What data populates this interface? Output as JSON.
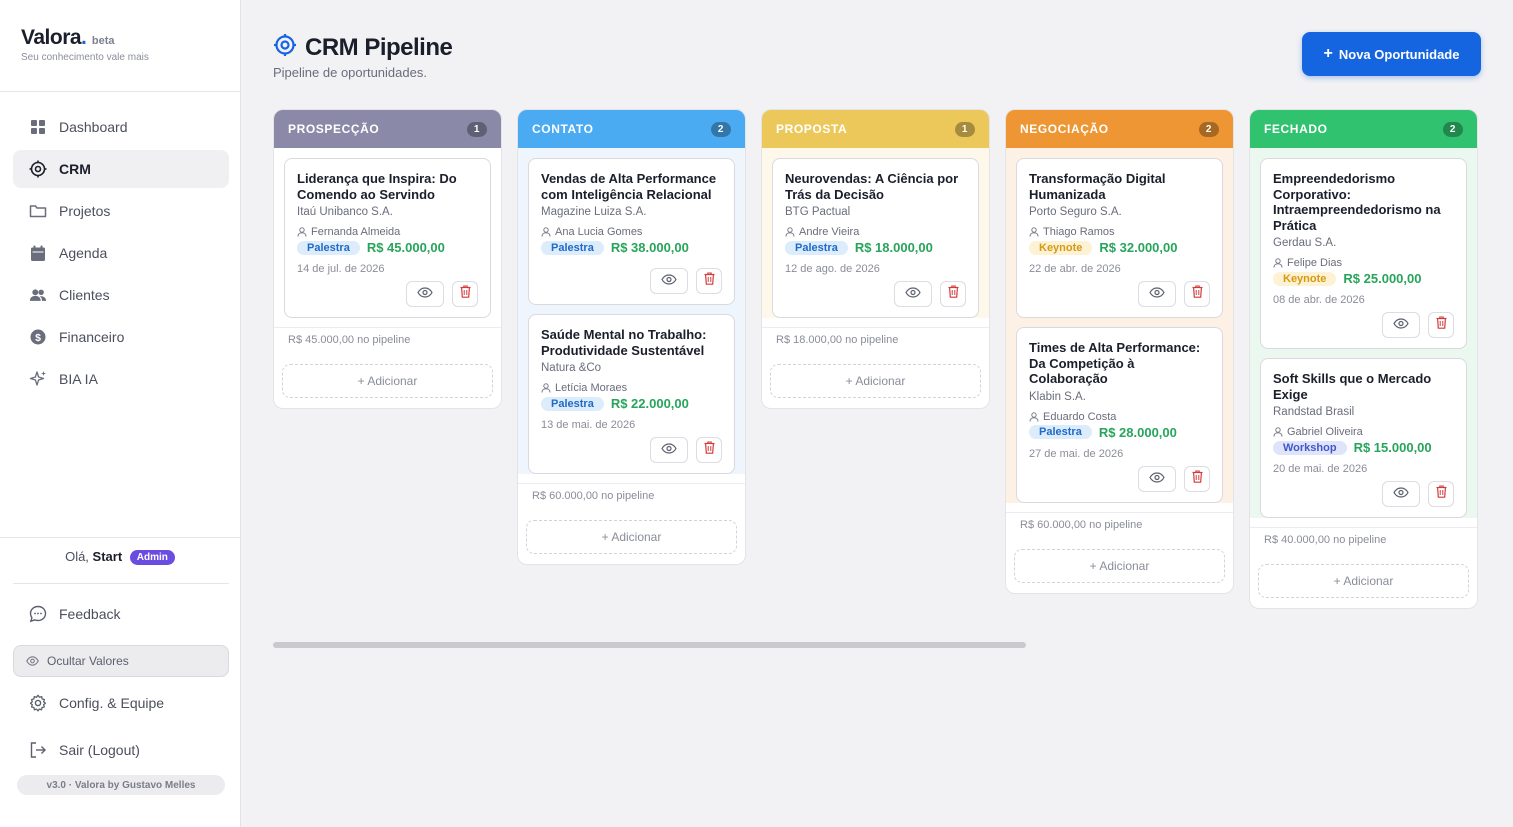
{
  "brand": {
    "name": "Valora",
    "dot": ".",
    "beta": "beta",
    "tagline": "Seu conhecimento vale mais"
  },
  "nav": [
    {
      "label": "Dashboard",
      "icon": "grid-icon"
    },
    {
      "label": "CRM",
      "icon": "target-icon",
      "active": true
    },
    {
      "label": "Projetos",
      "icon": "folder-icon"
    },
    {
      "label": "Agenda",
      "icon": "calendar-icon"
    },
    {
      "label": "Clientes",
      "icon": "users-icon"
    },
    {
      "label": "Financeiro",
      "icon": "dollar-icon"
    },
    {
      "label": "BIA IA",
      "icon": "sparkles-icon"
    }
  ],
  "user": {
    "greeting": "Olá,",
    "name": "Start",
    "role": "Admin"
  },
  "bottom": {
    "feedback": "Feedback",
    "hide_values": "Ocultar Valores",
    "settings": "Config. & Equipe",
    "logout": "Sair (Logout)",
    "version": "v3.0 · Valora by Gustavo Melles"
  },
  "header": {
    "title": "CRM Pipeline",
    "subtitle": "Pipeline de oportunidades.",
    "new_button": "Nova Oportunidade"
  },
  "colors": {
    "accent": "#1565e0",
    "prospeccao": "#8a8aa8",
    "contato": "#4aabf3",
    "proposta": "#ecc85a",
    "negociacao": "#ee9633",
    "fechado": "#31c26f"
  },
  "columns": [
    {
      "title": "PROSPECÇÃO",
      "count": "1",
      "cards": [
        {
          "title": "Liderança que Inspira: Do Comendo ao Servindo",
          "company": "Itaú Unibanco S.A.",
          "contact": "Fernanda Almeida",
          "tag": "Palestra",
          "amount": "R$ 45.000,00",
          "date": "14 de jul. de 2026"
        }
      ],
      "total": "R$ 45.000,00 no pipeline",
      "add": "+ Adicionar"
    },
    {
      "title": "CONTATO",
      "count": "2",
      "cards": [
        {
          "title": "Vendas de Alta Performance com Inteligência Relacional",
          "company": "Magazine Luiza S.A.",
          "contact": "Ana Lucia Gomes",
          "tag": "Palestra",
          "amount": "R$ 38.000,00",
          "date": ""
        },
        {
          "title": "Saúde Mental no Trabalho: Produtividade Sustentável",
          "company": "Natura &Co",
          "contact": "Letícia Moraes",
          "tag": "Palestra",
          "amount": "R$ 22.000,00",
          "date": "13 de mai. de 2026"
        }
      ],
      "total": "R$ 60.000,00 no pipeline",
      "add": "+ Adicionar"
    },
    {
      "title": "PROPOSTA",
      "count": "1",
      "cards": [
        {
          "title": "Neurovendas: A Ciência por Trás da Decisão",
          "company": "BTG Pactual",
          "contact": "Andre Vieira",
          "tag": "Palestra",
          "amount": "R$ 18.000,00",
          "date": "12 de ago. de 2026"
        }
      ],
      "total": "R$ 18.000,00 no pipeline",
      "add": "+ Adicionar"
    },
    {
      "title": "NEGOCIAÇÃO",
      "count": "2",
      "cards": [
        {
          "title": "Transformação Digital Humanizada",
          "company": "Porto Seguro S.A.",
          "contact": "Thiago Ramos",
          "tag": "Keynote",
          "amount": "R$ 32.000,00",
          "date": "22 de abr. de 2026"
        },
        {
          "title": "Times de Alta Performance: Da Competição à Colaboração",
          "company": "Klabin S.A.",
          "contact": "Eduardo Costa",
          "tag": "Palestra",
          "amount": "R$ 28.000,00",
          "date": "27 de mai. de 2026"
        }
      ],
      "total": "R$ 60.000,00 no pipeline",
      "add": "+ Adicionar"
    },
    {
      "title": "FECHADO",
      "count": "2",
      "cards": [
        {
          "title": "Empreendedorismo Corporativo: Intraempreendedorismo na Prática",
          "company": "Gerdau S.A.",
          "contact": "Felipe Dias",
          "tag": "Keynote",
          "amount": "R$ 25.000,00",
          "date": "08 de abr. de 2026"
        },
        {
          "title": "Soft Skills que o Mercado Exige",
          "company": "Randstad Brasil",
          "contact": "Gabriel Oliveira",
          "tag": "Workshop",
          "amount": "R$ 15.000,00",
          "date": "20 de mai. de 2026"
        }
      ],
      "total": "R$ 40.000,00 no pipeline",
      "add": "+ Adicionar"
    }
  ]
}
